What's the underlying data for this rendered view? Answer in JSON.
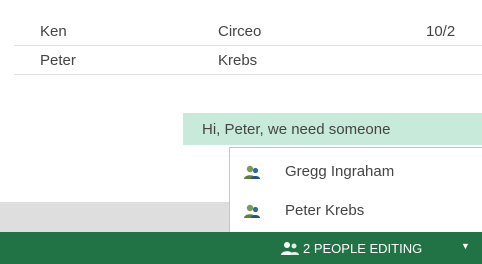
{
  "rows": [
    {
      "first": "Ken",
      "last": "Circeo",
      "date": "10/2"
    },
    {
      "first": "Peter",
      "last": "Krebs",
      "date": ""
    }
  ],
  "greeting": "Hi, Peter, we need someone",
  "editors_popup": {
    "items": [
      {
        "name": "Gregg Ingraham",
        "icon": "person-icon"
      },
      {
        "name": "Peter Krebs",
        "icon": "person-icon"
      }
    ]
  },
  "status_bar": {
    "editing_label": "2 PEOPLE EDITING",
    "caret": "▼",
    "icon": "people-icon"
  },
  "colors": {
    "status_bar": "#217346",
    "highlight": "#c8eadb"
  }
}
